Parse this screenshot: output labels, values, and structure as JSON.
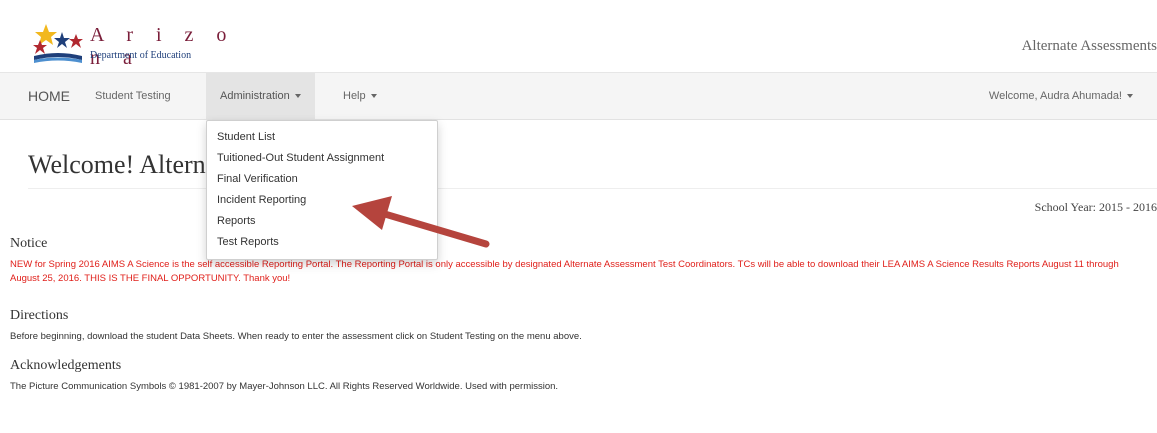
{
  "header": {
    "logo_word": "A r i z o n a",
    "logo_dept": "Department of Education",
    "app_title": "Alternate Assessments"
  },
  "nav": {
    "home": "HOME",
    "student_testing": "Student Testing",
    "administration": "Administration",
    "help": "Help",
    "welcome_user": "Welcome, Audra Ahumada!"
  },
  "admin_menu": {
    "items": [
      "Student List",
      "Tuitioned-Out Student Assignment",
      "Final Verification",
      "Incident Reporting",
      "Reports",
      "Test Reports"
    ]
  },
  "main": {
    "title": "Welcome! Alternate Assessments",
    "school_year": "School Year: 2015 - 2016",
    "notice": {
      "heading": "Notice",
      "text": "NEW for Spring 2016 AIMS A Science is the self accessible Reporting Portal. The Reporting Portal is only accessible by designated Alternate Assessment Test Coordinators. TCs will be able to download their LEA AIMS A Science Results Reports August 11 through August 25, 2016. THIS IS THE FINAL OPPORTUNITY. Thank you!"
    },
    "directions": {
      "heading": "Directions",
      "text": "Before beginning, download the student Data Sheets. When ready to enter the assessment click on Student Testing on the menu above."
    },
    "acknowledgements": {
      "heading": "Acknowledgements",
      "text": "The Picture Communication Symbols © 1981-2007 by Mayer-Johnson LLC. All Rights Reserved Worldwide. Used with permission."
    }
  },
  "icons": {
    "logo": "arizona-stars-logo",
    "caret": "chevron-down-icon",
    "annotation": "red-arrow-annotation"
  },
  "colors": {
    "notice_text": "#e0201b",
    "arrow": "#b5443d",
    "logo_word": "#7a1e3a"
  }
}
